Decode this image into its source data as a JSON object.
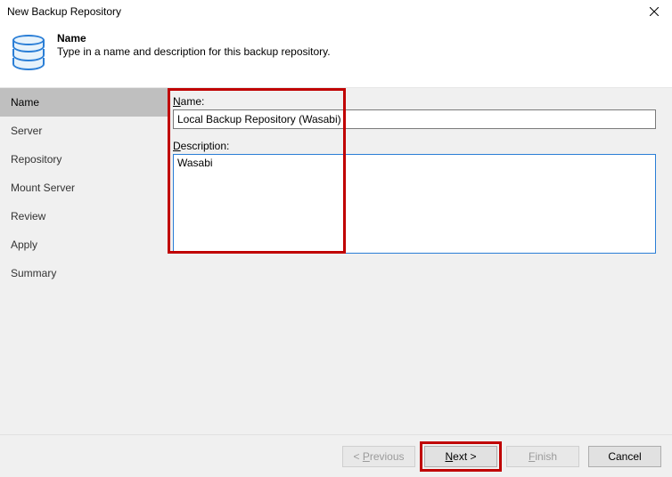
{
  "window": {
    "title": "New Backup Repository"
  },
  "header": {
    "title": "Name",
    "subtitle": "Type in a name and description for this backup repository."
  },
  "sidebar": {
    "items": [
      {
        "label": "Name",
        "active": true
      },
      {
        "label": "Server",
        "active": false
      },
      {
        "label": "Repository",
        "active": false
      },
      {
        "label": "Mount Server",
        "active": false
      },
      {
        "label": "Review",
        "active": false
      },
      {
        "label": "Apply",
        "active": false
      },
      {
        "label": "Summary",
        "active": false
      }
    ]
  },
  "form": {
    "name_label_prefix": "N",
    "name_label_rest": "ame:",
    "name_value": "Local Backup Repository (Wasabi)",
    "desc_label_prefix": "D",
    "desc_label_rest": "escription:",
    "desc_value": "Wasabi"
  },
  "buttons": {
    "previous_prefix": "< ",
    "previous_ul": "P",
    "previous_rest": "revious",
    "next_ul": "N",
    "next_rest": "ext >",
    "finish_ul": "F",
    "finish_rest": "inish",
    "cancel": "Cancel"
  }
}
